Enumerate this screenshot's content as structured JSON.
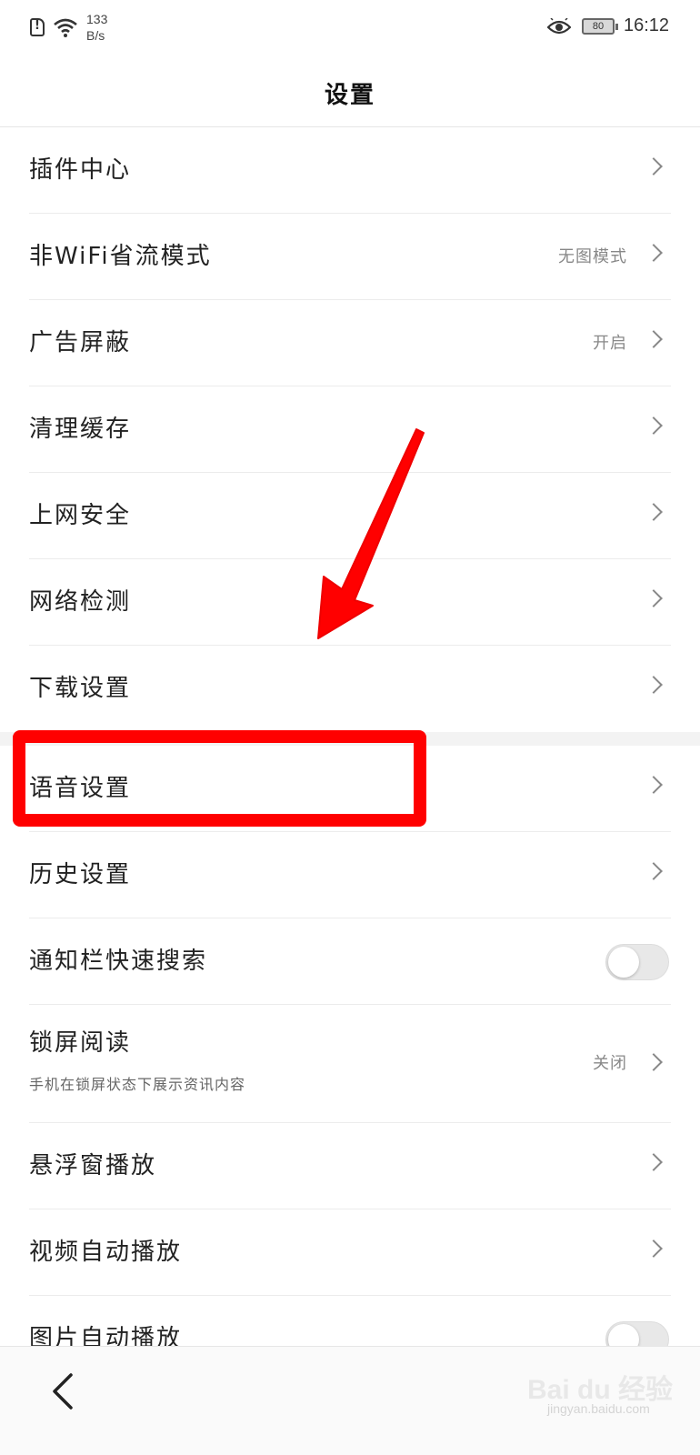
{
  "status_bar": {
    "net_speed_value": "133",
    "net_speed_unit": "B/s",
    "battery": "80",
    "time": "16:12"
  },
  "header": {
    "title": "设置"
  },
  "settings": [
    {
      "label": "插件中心"
    },
    {
      "label": "非WiFi省流模式",
      "value": "无图模式"
    },
    {
      "label": "广告屏蔽",
      "value": "开启"
    },
    {
      "label": "清理缓存"
    },
    {
      "label": "上网安全"
    },
    {
      "label": "网络检测"
    },
    {
      "label": "下载设置"
    },
    {
      "label": "语音设置"
    },
    {
      "label": "历史设置"
    },
    {
      "label": "通知栏快速搜索",
      "toggle": false
    },
    {
      "label": "锁屏阅读",
      "sublabel": "手机在锁屏状态下展示资讯内容",
      "value": "关闭"
    },
    {
      "label": "悬浮窗播放"
    },
    {
      "label": "视频自动播放"
    },
    {
      "label": "图片自动播放",
      "toggle": false
    }
  ],
  "watermark": {
    "brand": "Bai du 经验",
    "url": "jingyan.baidu.com"
  },
  "colors": {
    "annotation": "#ff0000",
    "text": "#222222",
    "secondary": "#888888"
  }
}
